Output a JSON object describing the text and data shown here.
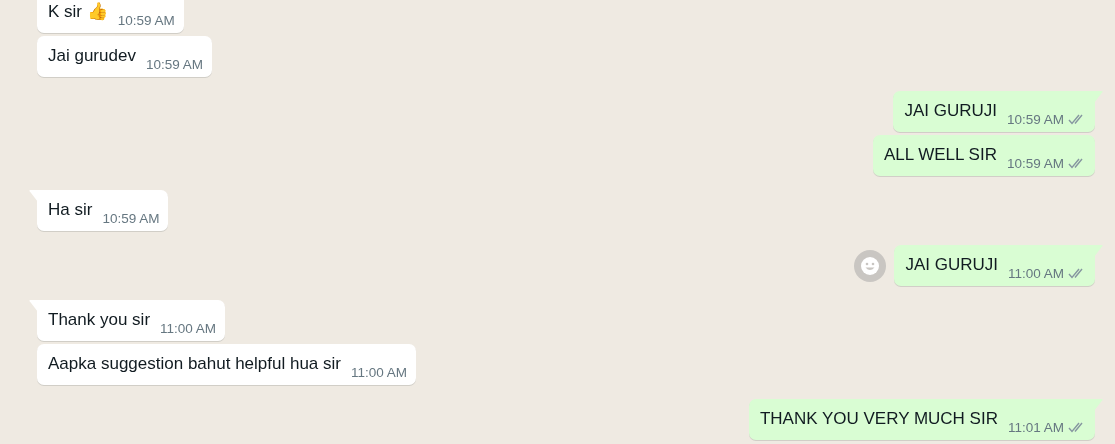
{
  "messages": [
    {
      "outgoing": false,
      "text": "K sir 👍",
      "time": "10:59 AM",
      "tail": false
    },
    {
      "outgoing": false,
      "text": "Jai gurudev",
      "time": "10:59 AM",
      "tail": false
    },
    {
      "outgoing": true,
      "text": "JAI GURUJI",
      "time": "10:59 AM",
      "tail": true,
      "read": false
    },
    {
      "outgoing": true,
      "text": "ALL WELL SIR",
      "time": "10:59 AM",
      "tail": false,
      "read": false
    },
    {
      "outgoing": false,
      "text": "Ha sir",
      "time": "10:59 AM",
      "tail": true
    },
    {
      "outgoing": true,
      "text": "JAI GURUJI",
      "time": "11:00 AM",
      "tail": true,
      "read": false,
      "emoji_button": true
    },
    {
      "outgoing": false,
      "text": "Thank you sir",
      "time": "11:00 AM",
      "tail": true
    },
    {
      "outgoing": false,
      "text": "Aapka suggestion bahut helpful hua sir",
      "time": "11:00 AM",
      "tail": false
    },
    {
      "outgoing": true,
      "text": "THANK YOU VERY MUCH SIR",
      "time": "11:01 AM",
      "tail": true,
      "read": false
    }
  ]
}
